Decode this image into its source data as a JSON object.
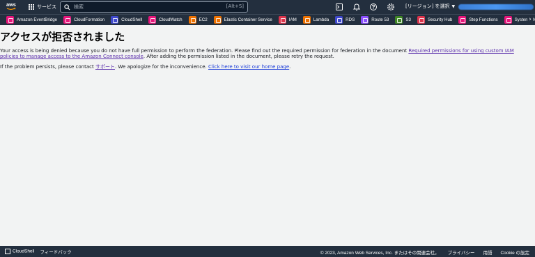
{
  "topnav": {
    "logo_text": "aws",
    "services_label": "サービス",
    "search_placeholder": "検索",
    "search_shortcut": "[Alt+S]",
    "region_label": "[リージョン] を選択",
    "icons": [
      "cloudshell-icon",
      "bell-icon",
      "help-icon",
      "gear-icon"
    ]
  },
  "favorites": [
    {
      "label": "Amazon EventBridge",
      "color": "#e7157b"
    },
    {
      "label": "CloudFormation",
      "color": "#e7157b"
    },
    {
      "label": "CloudShell",
      "color": "#3f48cc"
    },
    {
      "label": "CloudWatch",
      "color": "#e7157b"
    },
    {
      "label": "EC2",
      "color": "#ed7100"
    },
    {
      "label": "Elastic Container Service",
      "color": "#ed7100"
    },
    {
      "label": "IAM",
      "color": "#dd344c"
    },
    {
      "label": "Lambda",
      "color": "#ed7100"
    },
    {
      "label": "RDS",
      "color": "#3f48cc"
    },
    {
      "label": "Route 53",
      "color": "#8c4fff"
    },
    {
      "label": "S3",
      "color": "#3f8624"
    },
    {
      "label": "Security Hub",
      "color": "#dd344c"
    },
    {
      "label": "Step Functions",
      "color": "#e7157b"
    },
    {
      "label": "Systems Man",
      "color": "#e7157b"
    }
  ],
  "main": {
    "title": "アクセスが拒否されました",
    "message1_prefix": "Your access is being denied because you do not have full permission to perform the federation. Please find out the required permission for federation in the document ",
    "message1_link": "Required permissions for using custom IAM policies to manage access to the Amazon Connect console",
    "message1_suffix": ". After adding the permission listed in the document, please retry the request.",
    "message2_prefix": "If the problem persists, please contact ",
    "message2_support_link": "サポート",
    "message2_middle": ". We apologize for the inconvenience. ",
    "message2_home_link": "Click here to visit our home page",
    "message2_suffix": "."
  },
  "footer": {
    "cloudshell": "CloudShell",
    "feedback": "フィードバック",
    "copyright": "© 2023, Amazon Web Services, Inc. またはその関連会社。",
    "privacy": "プライバシー",
    "terms": "用語",
    "cookies": "Cookie の設定"
  }
}
